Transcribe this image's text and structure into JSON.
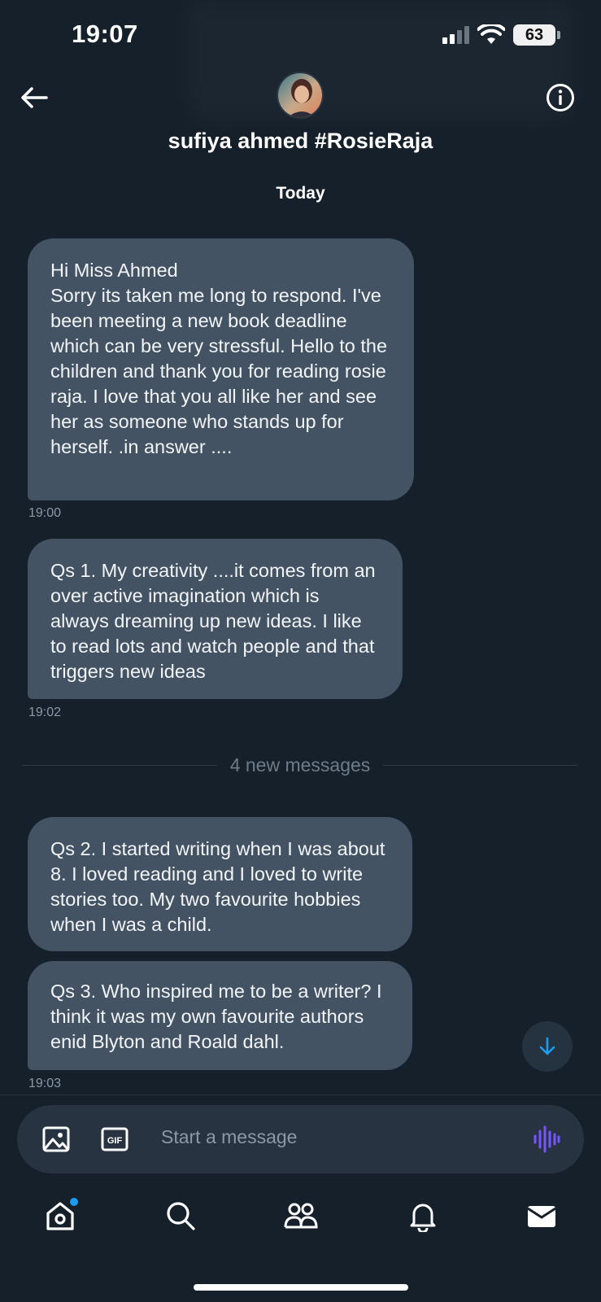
{
  "status_bar": {
    "time": "19:07",
    "battery": "63"
  },
  "header": {
    "name": "sufiya ahmed #RosieRaja"
  },
  "conversation": {
    "day_label": "Today",
    "messages": [
      {
        "text": "Hi Miss Ahmed\nSorry its taken me long to respond. I've been meeting a new book deadline which can be very stressful. Hello to the children and thank you for reading rosie raja. I love that you all like her and see her as someone who stands up for herself. .in answer ....",
        "time": "19:00"
      },
      {
        "text": "Qs 1. My creativity ....it comes from an over active imagination which is always dreaming up new ideas. I like to read lots and watch people and that triggers new ideas",
        "time": "19:02"
      },
      {
        "text": "Qs 2. I started writing when I was about 8. I loved reading and I loved to write stories too. My two favourite hobbies when I was a child."
      },
      {
        "text": "Qs 3. Who inspired me to be a writer? I think it was my own favourite authors enid Blyton and Roald dahl.",
        "time": "19:03"
      }
    ],
    "new_messages_label": "4 new messages"
  },
  "composer": {
    "placeholder": "Start a message"
  },
  "tabbar": {
    "items": [
      "home-icon",
      "search-icon",
      "communities-icon",
      "notifications-icon",
      "messages-icon"
    ],
    "accent": "#1d9bf0"
  },
  "colors": {
    "background": "#15202b",
    "bubble": "#435364",
    "accent_voice": "#7856ff"
  }
}
